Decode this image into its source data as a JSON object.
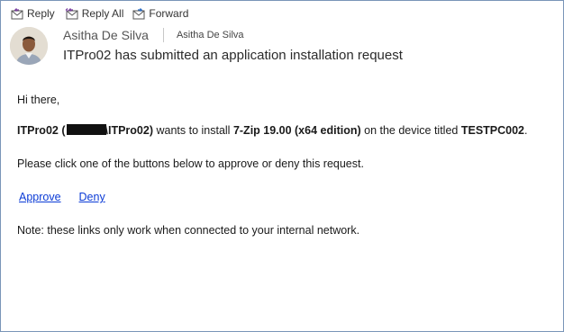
{
  "toolbar": {
    "reply": "Reply",
    "reply_all": "Reply All",
    "forward": "Forward"
  },
  "header": {
    "sender_name": "Asitha De Silva",
    "sender_address": "Asitha De Silva",
    "subject": "ITPro02 has submitted an application installation request"
  },
  "body": {
    "greeting": "Hi there,",
    "req_user": "ITPro02 (",
    "req_user_tail": "\\ITPro02)",
    "req_mid": " wants to install ",
    "req_app": "7-Zip 19.00 (x64 edition)",
    "req_mid2": " on the device titled ",
    "req_device": "TESTPC002",
    "req_end": ".",
    "instruction": "Please click one of the buttons below to approve or deny this request.",
    "approve": "Approve",
    "deny": "Deny",
    "note": "Note: these links only work when connected to your internal network."
  },
  "colors": {
    "link": "#0b3bd6",
    "frame_border": "#7a95b8"
  },
  "icons": [
    "reply-icon",
    "reply-all-icon",
    "forward-icon"
  ]
}
